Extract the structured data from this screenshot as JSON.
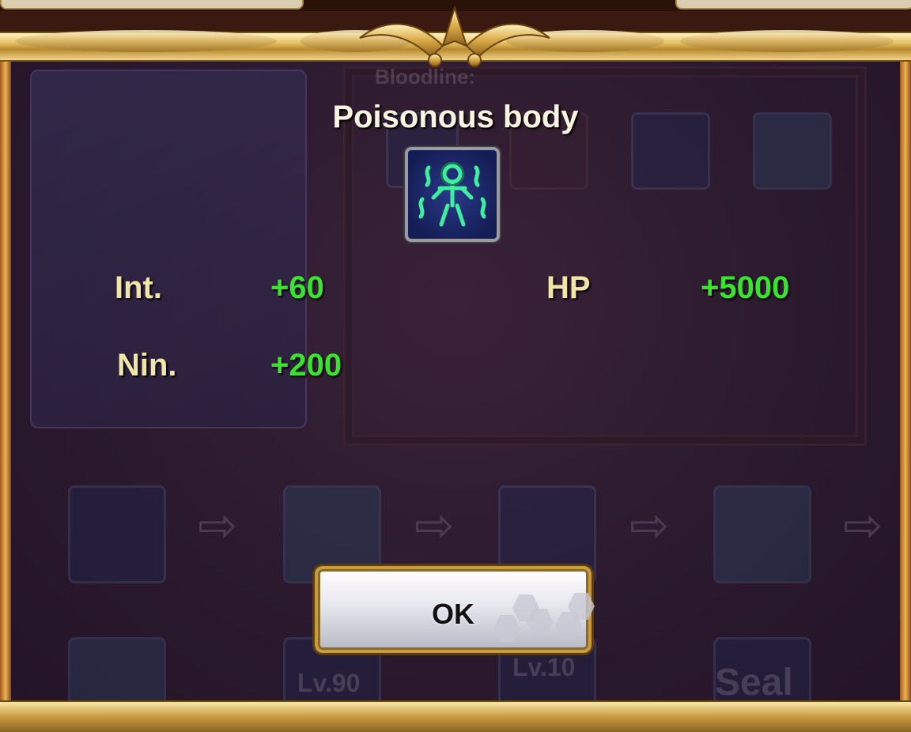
{
  "popup": {
    "title": "Poisonous body",
    "skill_icon": "poison-body-skill-icon",
    "stats_left": [
      {
        "label": "Int.",
        "value": "+60"
      },
      {
        "label": "Nin.",
        "value": "+200"
      }
    ],
    "stats_right": [
      {
        "label": "HP",
        "value": "+5000"
      }
    ],
    "ok_label": "OK"
  },
  "background": {
    "section_label": "Bloodline:",
    "level_tags": [
      "Lv.90",
      "Lv.10"
    ],
    "seal_label": "Seal"
  },
  "colors": {
    "stat_label": "#f1e6a6",
    "stat_value": "#37e62a",
    "title": "#fbf4e0",
    "frame_gold": "#e8c36a"
  }
}
